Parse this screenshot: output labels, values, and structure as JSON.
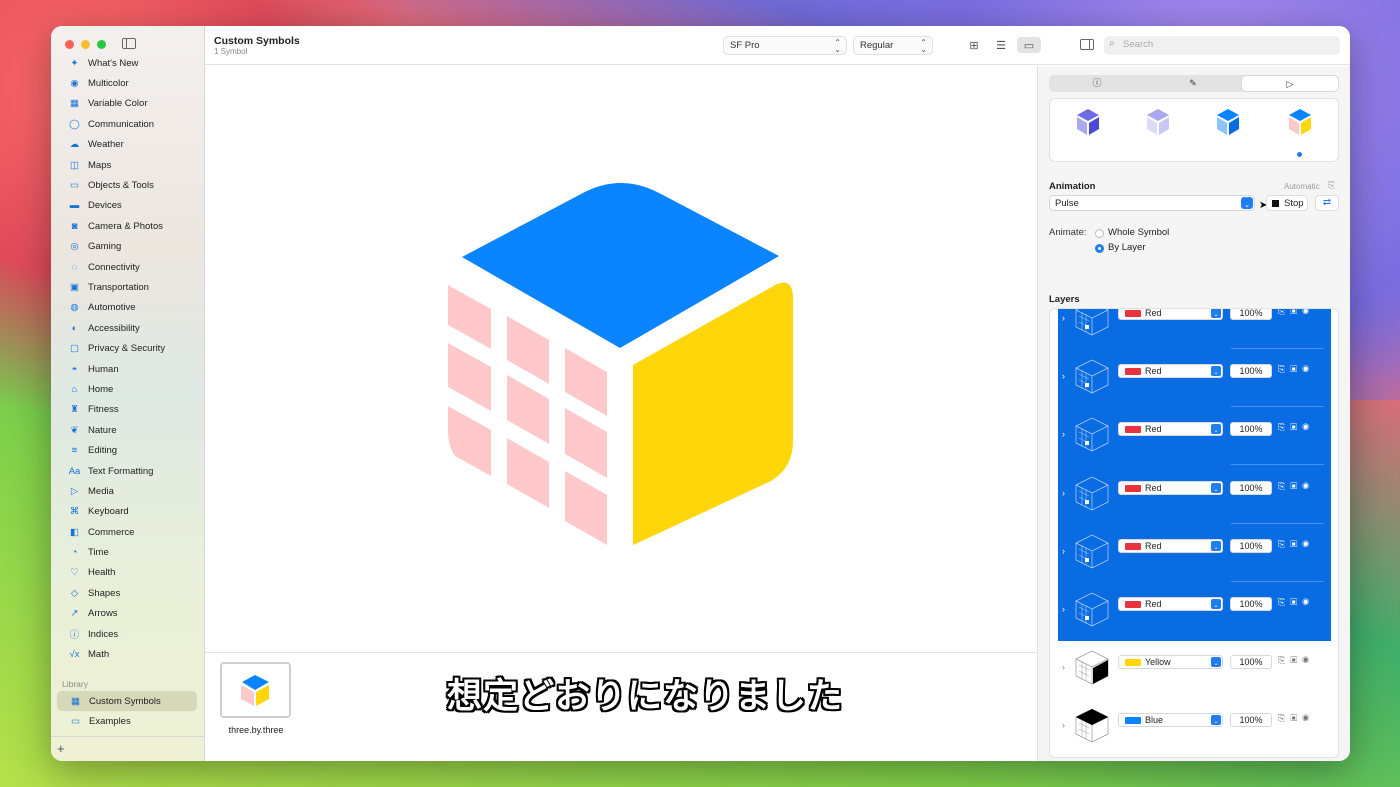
{
  "window": {
    "title": "Custom Symbols",
    "subtitle": "1 Symbol"
  },
  "toolbar": {
    "font": "SF Pro",
    "weight": "Regular",
    "search_placeholder": "Search"
  },
  "sidebar": {
    "categories": [
      {
        "label": "What's New",
        "icon": "✦"
      },
      {
        "label": "Multicolor",
        "icon": "◉"
      },
      {
        "label": "Variable Color",
        "icon": "▦"
      },
      {
        "label": "Communication",
        "icon": "◯"
      },
      {
        "label": "Weather",
        "icon": "☁"
      },
      {
        "label": "Maps",
        "icon": "◫"
      },
      {
        "label": "Objects & Tools",
        "icon": "▭"
      },
      {
        "label": "Devices",
        "icon": "▬"
      },
      {
        "label": "Camera & Photos",
        "icon": "◙"
      },
      {
        "label": "Gaming",
        "icon": "◎"
      },
      {
        "label": "Connectivity",
        "icon": "◌"
      },
      {
        "label": "Transportation",
        "icon": "▣"
      },
      {
        "label": "Automotive",
        "icon": "◍"
      },
      {
        "label": "Accessibility",
        "icon": "◐"
      },
      {
        "label": "Privacy & Security",
        "icon": "▢"
      },
      {
        "label": "Human",
        "icon": "◓"
      },
      {
        "label": "Home",
        "icon": "⌂"
      },
      {
        "label": "Fitness",
        "icon": "♜"
      },
      {
        "label": "Nature",
        "icon": "❦"
      },
      {
        "label": "Editing",
        "icon": "≡"
      },
      {
        "label": "Text Formatting",
        "icon": "Aa"
      },
      {
        "label": "Media",
        "icon": "▷"
      },
      {
        "label": "Keyboard",
        "icon": "⌘"
      },
      {
        "label": "Commerce",
        "icon": "◧"
      },
      {
        "label": "Time",
        "icon": "◔"
      },
      {
        "label": "Health",
        "icon": "♡"
      },
      {
        "label": "Shapes",
        "icon": "◇"
      },
      {
        "label": "Arrows",
        "icon": "↗"
      },
      {
        "label": "Indices",
        "icon": "ⓘ"
      },
      {
        "label": "Math",
        "icon": "√x"
      }
    ],
    "library_header": "Library",
    "library": [
      {
        "label": "Custom Symbols",
        "icon": "▦",
        "selected": true
      },
      {
        "label": "Examples",
        "icon": "▭",
        "selected": false
      }
    ],
    "add": "+"
  },
  "gallery": {
    "thumb_label": "three.by.three"
  },
  "caption": "想定どおりになりました",
  "inspector": {
    "tabs": [
      "ⓘ",
      "✎",
      "▷"
    ],
    "animation_title": "Animation",
    "automatic": "Automatic",
    "effect": "Pulse",
    "stop": "Stop",
    "animate_label": "Animate:",
    "animate_options": [
      "Whole Symbol",
      "By Layer"
    ],
    "animate_selected": "By Layer",
    "layers_title": "Layers",
    "layers": [
      {
        "color_name": "Red",
        "swatch": "#e8323e",
        "opacity": "100%",
        "selected": true
      },
      {
        "color_name": "Red",
        "swatch": "#e8323e",
        "opacity": "100%",
        "selected": true
      },
      {
        "color_name": "Red",
        "swatch": "#e8323e",
        "opacity": "100%",
        "selected": true
      },
      {
        "color_name": "Red",
        "swatch": "#e8323e",
        "opacity": "100%",
        "selected": true
      },
      {
        "color_name": "Red",
        "swatch": "#e8323e",
        "opacity": "100%",
        "selected": true
      },
      {
        "color_name": "Red",
        "swatch": "#e8323e",
        "opacity": "100%",
        "selected": true
      },
      {
        "color_name": "Yellow",
        "swatch": "#ffd60a",
        "opacity": "100%",
        "selected": false
      },
      {
        "color_name": "Blue",
        "swatch": "#0a84ff",
        "opacity": "100%",
        "selected": false
      }
    ],
    "footer_add": "+⌄",
    "footer_more": "⊖⌄"
  },
  "colors": {
    "accent": "#1f7ef2",
    "cube_top": "#0a84ff",
    "cube_right": "#ffd60a",
    "cube_grid": "#ffc9cc"
  }
}
